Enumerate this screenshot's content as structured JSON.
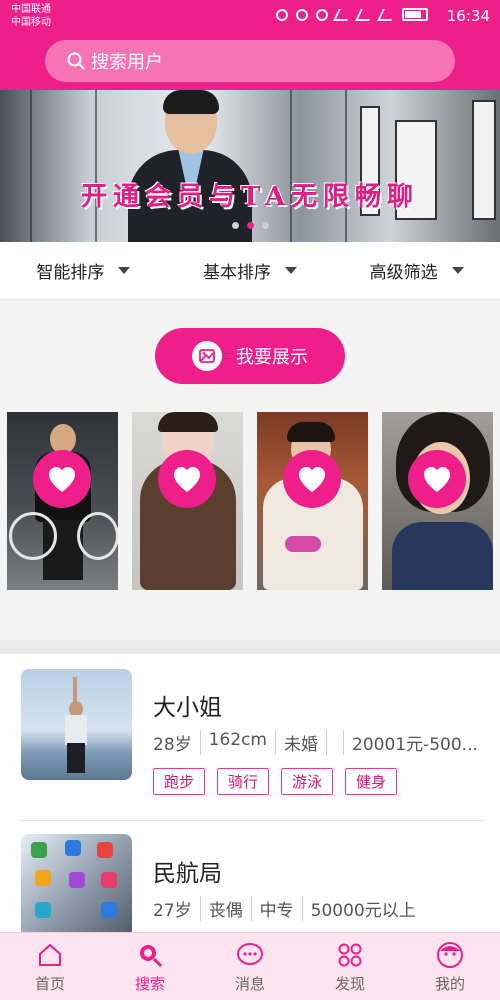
{
  "status_bar": {
    "carrier1": "中国联通",
    "carrier2": "中国移动",
    "time": "16:34"
  },
  "search": {
    "placeholder": "搜索用户",
    "icon": "search-icon"
  },
  "banner": {
    "text": "开通会员与TA无限畅聊",
    "slides": 3,
    "active_slide": 1
  },
  "filters": [
    {
      "label": "智能排序"
    },
    {
      "label": "基本排序"
    },
    {
      "label": "高级筛选"
    }
  ],
  "showcase": {
    "button_label": "我要展示",
    "button_icon": "image-icon",
    "photo_count": 4,
    "like_icon": "heart-icon"
  },
  "list": [
    {
      "name": "大小姐",
      "age": "28岁",
      "height": "162cm",
      "marital": "未婚",
      "extra": "",
      "income": "20001元-500...",
      "tags": [
        "跑步",
        "骑行",
        "游泳",
        "健身"
      ]
    },
    {
      "name": "民航局",
      "age": "27岁",
      "marital": "丧偶",
      "education": "中专",
      "income": "50000元以上"
    }
  ],
  "tabbar": [
    {
      "label": "首页",
      "icon": "home-icon"
    },
    {
      "label": "搜索",
      "icon": "search-icon",
      "active": true
    },
    {
      "label": "消息",
      "icon": "chat-icon"
    },
    {
      "label": "发现",
      "icon": "discover-icon"
    },
    {
      "label": "我的",
      "icon": "profile-icon"
    }
  ],
  "colors": {
    "accent": "#ee1f8b",
    "tab_bg": "#fde4ef",
    "search_bg": "#f673b4"
  }
}
